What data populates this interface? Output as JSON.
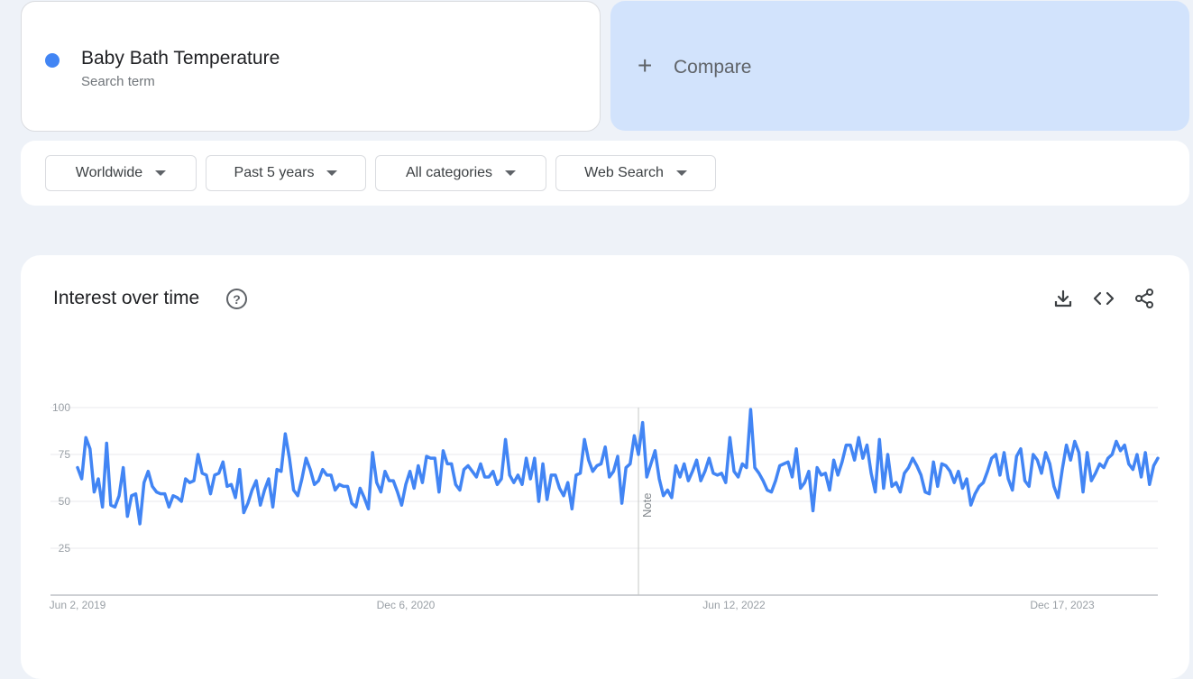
{
  "search_term": {
    "name": "Baby Bath Temperature",
    "subtitle": "Search term",
    "dot_color": "#4285f4"
  },
  "compare": {
    "icon": "plus-icon",
    "label": "Compare"
  },
  "filters": [
    {
      "label": "Worldwide"
    },
    {
      "label": "Past 5 years"
    },
    {
      "label": "All categories"
    },
    {
      "label": "Web Search"
    }
  ],
  "chart_header": {
    "title": "Interest over time",
    "help_icon": "help-circle-icon",
    "help_label": "?",
    "tools": [
      "download-icon",
      "embed-code-icon",
      "share-icon"
    ]
  },
  "chart_data": {
    "type": "line",
    "title": "",
    "xlabel": "",
    "ylabel": "",
    "ylim": [
      0,
      100
    ],
    "yticks": [
      25,
      50,
      75,
      100
    ],
    "grid": true,
    "x_start": "2019-06-02",
    "x_step_days": 7,
    "x_tick_labels": [
      {
        "label": "Jun 2, 2019",
        "index": 0
      },
      {
        "label": "Dec 6, 2020",
        "index": 79
      },
      {
        "label": "Jun 12, 2022",
        "index": 158
      },
      {
        "label": "Dec 17, 2023",
        "index": 237
      }
    ],
    "note": {
      "label": "Note",
      "index": 135
    },
    "color": "#4285f4",
    "series": [
      {
        "values": [
          68,
          62,
          84,
          78,
          55,
          62,
          47,
          81,
          48,
          47,
          53,
          68,
          42,
          53,
          54,
          38,
          60,
          66,
          58,
          55,
          54,
          54,
          47,
          53,
          52,
          50,
          62,
          60,
          61,
          75,
          65,
          64,
          54,
          64,
          65,
          71,
          58,
          59,
          52,
          67,
          44,
          49,
          56,
          61,
          48,
          56,
          62,
          47,
          67,
          66,
          86,
          73,
          56,
          53,
          62,
          73,
          67,
          59,
          61,
          67,
          64,
          64,
          56,
          59,
          58,
          58,
          49,
          47,
          57,
          52,
          46,
          76,
          60,
          55,
          66,
          61,
          61,
          55,
          48,
          59,
          66,
          57,
          69,
          60,
          74,
          73,
          73,
          55,
          77,
          70,
          70,
          59,
          56,
          67,
          69,
          66,
          63,
          70,
          63,
          63,
          66,
          59,
          62,
          83,
          64,
          60,
          64,
          59,
          73,
          62,
          73,
          50,
          70,
          51,
          64,
          64,
          57,
          53,
          60,
          46,
          64,
          65,
          83,
          72,
          66,
          69,
          70,
          79,
          63,
          66,
          74,
          49,
          68,
          70,
          85,
          75,
          92,
          63,
          70,
          77,
          62,
          53,
          56,
          52,
          69,
          63,
          70,
          61,
          66,
          72,
          61,
          66,
          73,
          65,
          64,
          65,
          60,
          84,
          66,
          63,
          70,
          68,
          99,
          68,
          65,
          61,
          56,
          55,
          61,
          69,
          70,
          71,
          63,
          78,
          57,
          60,
          66,
          45,
          68,
          64,
          65,
          56,
          72,
          64,
          71,
          80,
          80,
          72,
          84,
          73,
          80,
          65,
          55,
          83,
          57,
          75,
          58,
          60,
          55,
          65,
          68,
          73,
          69,
          64,
          55,
          54,
          71,
          58,
          70,
          69,
          66,
          60,
          66,
          57,
          62,
          48,
          54,
          58,
          60,
          66,
          73,
          75,
          64,
          76,
          62,
          56,
          74,
          78,
          61,
          58,
          75,
          72,
          65,
          76,
          70,
          58,
          52,
          67,
          80,
          72,
          82,
          76,
          55,
          76,
          61,
          65,
          70,
          68,
          73,
          75,
          82,
          77,
          80,
          70,
          67,
          75,
          63,
          76,
          59,
          69,
          73
        ]
      }
    ]
  }
}
